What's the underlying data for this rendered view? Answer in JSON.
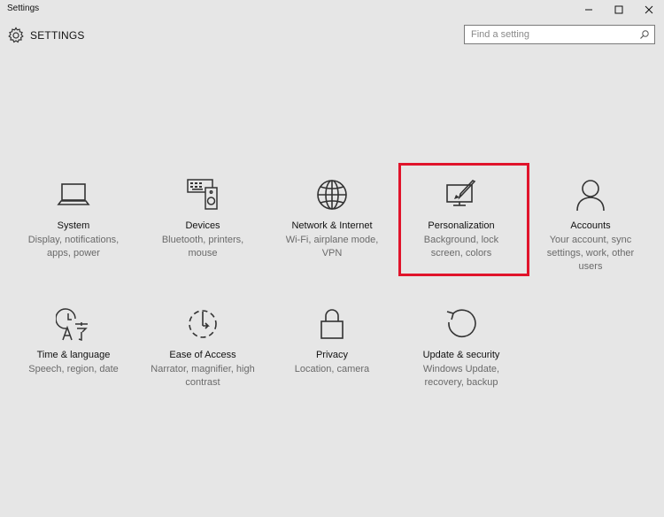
{
  "window": {
    "title": "Settings"
  },
  "header": {
    "title": "SETTINGS"
  },
  "search": {
    "placeholder": "Find a setting",
    "value": ""
  },
  "tiles": [
    {
      "title": "System",
      "desc": "Display, notifications, apps, power",
      "icon": "laptop-icon"
    },
    {
      "title": "Devices",
      "desc": "Bluetooth, printers, mouse",
      "icon": "devices-icon"
    },
    {
      "title": "Network & Internet",
      "desc": "Wi-Fi, airplane mode, VPN",
      "icon": "globe-icon"
    },
    {
      "title": "Personalization",
      "desc": "Background, lock screen, colors",
      "icon": "personalization-icon"
    },
    {
      "title": "Accounts",
      "desc": "Your account, sync settings, work, other users",
      "icon": "person-icon"
    },
    {
      "title": "Time & language",
      "desc": "Speech, region, date",
      "icon": "time-language-icon"
    },
    {
      "title": "Ease of Access",
      "desc": "Narrator, magnifier, high contrast",
      "icon": "ease-of-access-icon"
    },
    {
      "title": "Privacy",
      "desc": "Location, camera",
      "icon": "lock-icon"
    },
    {
      "title": "Update & security",
      "desc": "Windows Update, recovery, backup",
      "icon": "update-icon"
    }
  ],
  "colors": {
    "background": "#e6e6e6",
    "highlight": "#e0142b",
    "icon": "#333333",
    "desc_text": "#6a6a6a"
  }
}
